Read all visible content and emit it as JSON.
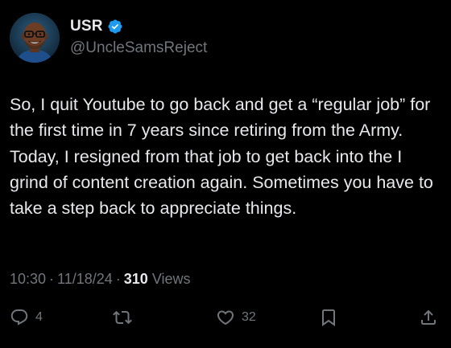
{
  "author": {
    "display_name": "USR",
    "handle": "@UncleSamsReject",
    "verified": true,
    "avatar_icon": "profile-photo-smiling-man-glasses"
  },
  "tweet": {
    "text": "So, I quit Youtube to go back and get a “regular job” for the first time in 7 years since retiring from the Army. Today, I resigned from that job to get back into the I grind of content creation again. Sometimes you have to take a step back to appreciate things."
  },
  "meta": {
    "time": "10:30",
    "separator": "·",
    "date": "11/18/24",
    "views_count": "310",
    "views_label": "Views"
  },
  "actions": {
    "reply": {
      "icon": "reply-icon",
      "count": "4"
    },
    "retweet": {
      "icon": "retweet-icon",
      "count": ""
    },
    "like": {
      "icon": "heart-icon",
      "count": "32"
    },
    "bookmark": {
      "icon": "bookmark-icon",
      "count": ""
    },
    "share": {
      "icon": "share-icon",
      "count": ""
    }
  },
  "colors": {
    "background": "#000000",
    "primary_text": "#e7e9ea",
    "secondary_text": "#71767b",
    "verified_blue": "#1d9bf0"
  }
}
